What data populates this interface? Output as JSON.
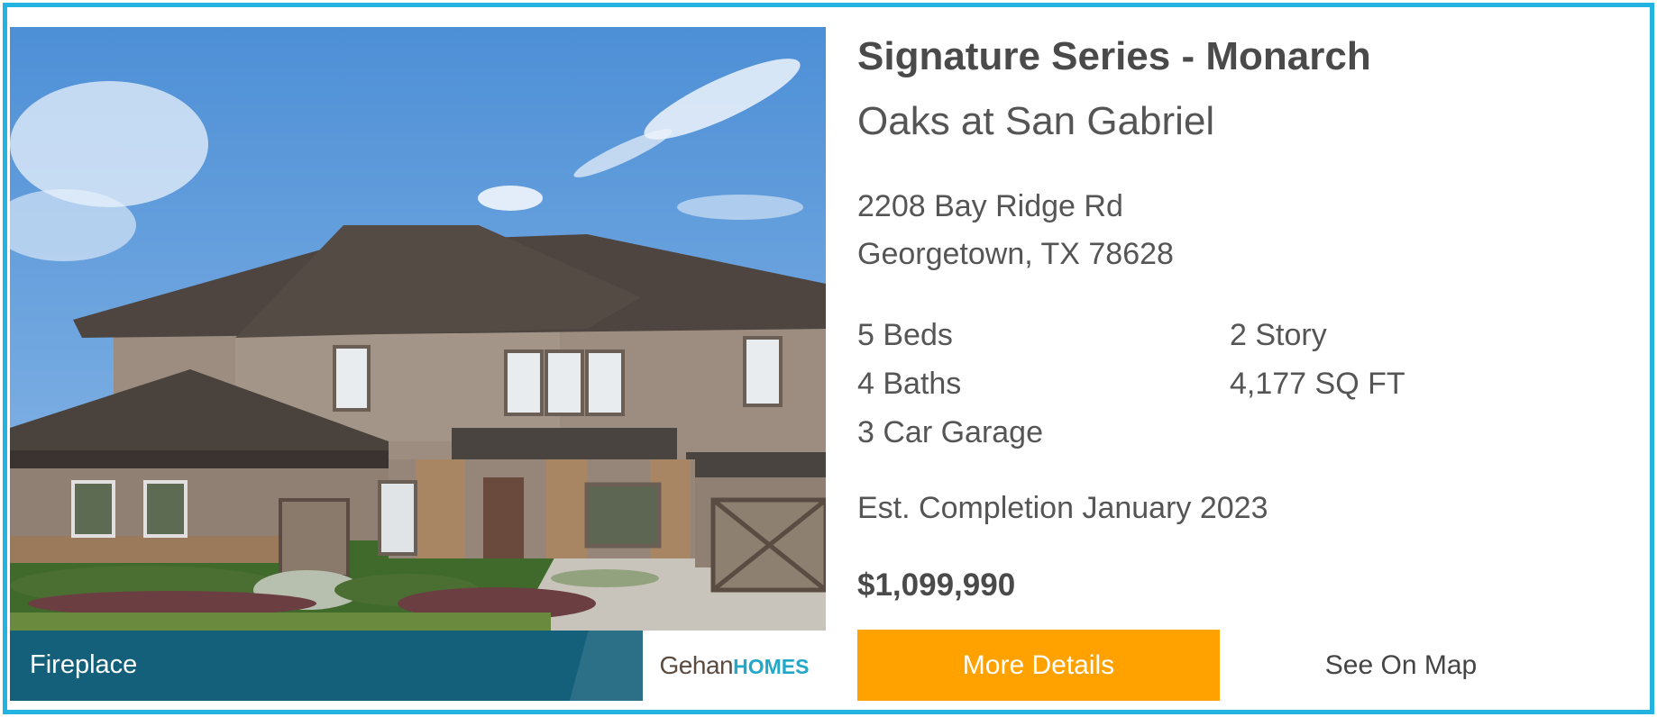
{
  "listing": {
    "title": "Signature Series - Monarch",
    "community": "Oaks at San Gabriel",
    "address_line1": "2208 Bay Ridge Rd",
    "address_line2": "Georgetown, TX 78628",
    "beds": "5 Beds",
    "baths": "4 Baths",
    "garage": "3 Car Garage",
    "stories": "2 Story",
    "sqft": "4,177 SQ FT",
    "completion": "Est. Completion January 2023",
    "price": "$1,099,990"
  },
  "media": {
    "feature_label": "Fireplace",
    "builder_logo": {
      "part1": "Gehan",
      "part2": "HOMES"
    },
    "photo_icon": "house-exterior-rendering"
  },
  "actions": {
    "details_label": "More Details",
    "map_label": "See On Map"
  },
  "colors": {
    "border": "#23b3e0",
    "primary_button": "#ffa200",
    "feature_bar": "#14607a",
    "text": "#4a4a4a",
    "logo_brown": "#5a4a3f",
    "logo_teal": "#23a8c8"
  }
}
